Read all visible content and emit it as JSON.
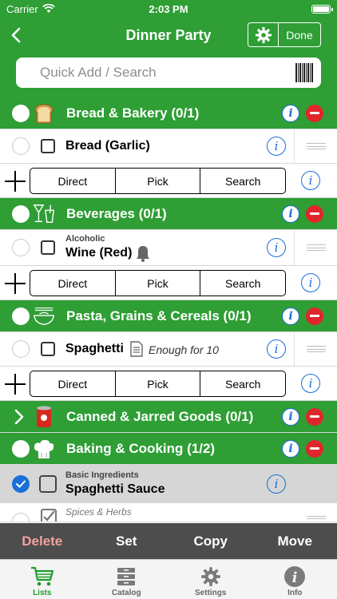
{
  "status": {
    "carrier": "Carrier",
    "time": "2:03 PM",
    "battery_level": 1.0
  },
  "nav": {
    "title": "Dinner Party",
    "done_label": "Done"
  },
  "search": {
    "placeholder": "Quick Add / Search"
  },
  "colors": {
    "brand_green": "#2e9e35",
    "info_blue": "#1a6ed8",
    "delete_red": "#e0262b",
    "action_bar": "#4d4d4d"
  },
  "categories": [
    {
      "label": "Bread & Bakery (0/1)",
      "icon": "bread-icon"
    },
    {
      "label": "Beverages (0/1)",
      "icon": "beverages-icon"
    },
    {
      "label": "Pasta, Grains & Cereals (0/1)",
      "icon": "pasta-bowl-icon"
    },
    {
      "label": "Canned & Jarred Goods (0/1)",
      "icon": "can-icon",
      "collapsed": true
    },
    {
      "label": "Baking & Cooking (1/2)",
      "icon": "chef-hat-icon"
    }
  ],
  "items": {
    "bread": {
      "name": "Bread (Garlic)"
    },
    "wine": {
      "subtitle": "Alcoholic",
      "name": "Wine (Red)"
    },
    "spaghetti": {
      "name": "Spaghetti",
      "note": "Enough for 10"
    },
    "sauce": {
      "subtitle": "Basic Ingredients",
      "name": "Spaghetti Sauce"
    },
    "spices": {
      "subtitle": "Spices & Herbs"
    }
  },
  "add_controls": {
    "direct": "Direct",
    "pick": "Pick",
    "search": "Search"
  },
  "action_bar": {
    "delete": "Delete",
    "set": "Set",
    "copy": "Copy",
    "move": "Move"
  },
  "tabs": [
    {
      "label": "Lists",
      "icon": "cart-icon",
      "active": true
    },
    {
      "label": "Catalog",
      "icon": "catalog-icon"
    },
    {
      "label": "Settings",
      "icon": "gear-icon"
    },
    {
      "label": "Info",
      "icon": "info-icon"
    }
  ]
}
